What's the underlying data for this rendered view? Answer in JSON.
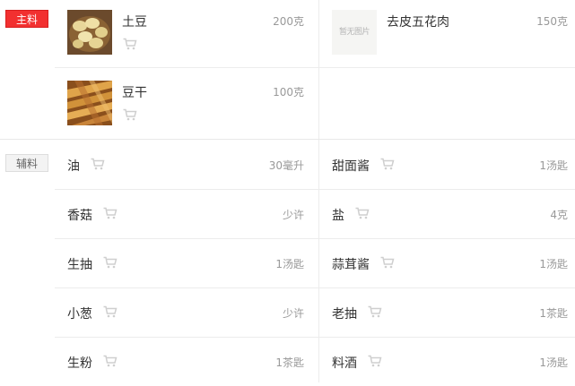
{
  "main": {
    "tag": "主料",
    "items": [
      {
        "name": "土豆",
        "qty": "200克",
        "image": "potato-photo"
      },
      {
        "name": "去皮五花肉",
        "qty": "150克",
        "image": "no-image",
        "placeholder": "暂无图片"
      },
      {
        "name": "豆干",
        "qty": "100克",
        "image": "dried-tofu-photo"
      }
    ]
  },
  "aux": {
    "tag": "辅料",
    "items": [
      {
        "name": "油",
        "qty": "30毫升"
      },
      {
        "name": "甜面酱",
        "qty": "1汤匙"
      },
      {
        "name": "香菇",
        "qty": "少许"
      },
      {
        "name": "盐",
        "qty": "4克"
      },
      {
        "name": "生抽",
        "qty": "1汤匙"
      },
      {
        "name": "蒜茸酱",
        "qty": "1汤匙"
      },
      {
        "name": "小葱",
        "qty": "少许"
      },
      {
        "name": "老抽",
        "qty": "1茶匙"
      },
      {
        "name": "生粉",
        "qty": "1茶匙"
      },
      {
        "name": "料酒",
        "qty": "1汤匙"
      }
    ]
  },
  "icons": {
    "cart": "shopping-cart-icon"
  },
  "colors": {
    "main_tag": "#f23030",
    "cart": "#cfcfcf",
    "qty_text": "#999999"
  }
}
